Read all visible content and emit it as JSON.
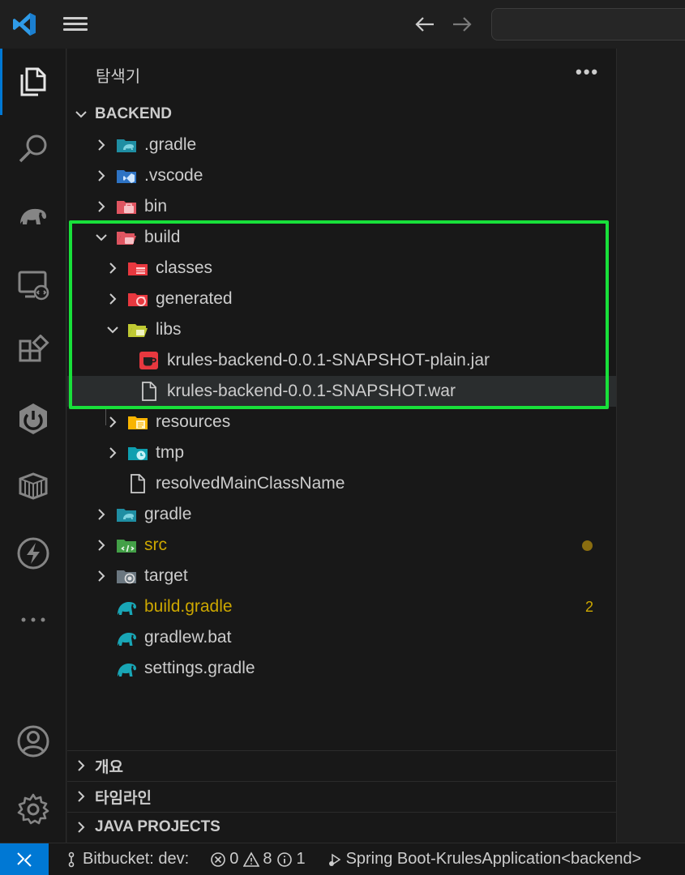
{
  "titlebar": {
    "logo": "vscode-logo",
    "menu_icon": "hamburger-icon",
    "back_icon": "arrow-left-icon",
    "forward_icon": "arrow-right-icon"
  },
  "activity_bar": {
    "items": [
      "explorer-icon",
      "search-icon",
      "gradle-elephant-icon",
      "remote-explorer-icon",
      "extensions-icon",
      "spring-boot-icon",
      "package-icon",
      "lightning-icon",
      "more-icon"
    ],
    "bottom": [
      "account-icon",
      "settings-gear-icon"
    ],
    "accent": "#0078d4"
  },
  "explorer": {
    "title": "탐색기",
    "more_label": "•••",
    "root_label": "BACKEND",
    "tree": [
      {
        "label": ".gradle",
        "icon": "folder-gradle-icon"
      },
      {
        "label": ".vscode",
        "icon": "folder-vscode-icon"
      },
      {
        "label": "bin",
        "icon": "folder-bin-icon"
      },
      {
        "label": "build",
        "icon": "folder-build-open-icon"
      },
      {
        "label": "classes",
        "icon": "folder-classes-icon"
      },
      {
        "label": "generated",
        "icon": "folder-generated-icon"
      },
      {
        "label": "libs",
        "icon": "folder-libs-open-icon"
      },
      {
        "label": "krules-backend-0.0.1-SNAPSHOT-plain.jar",
        "icon": "java-jar-icon"
      },
      {
        "label": "krules-backend-0.0.1-SNAPSHOT.war",
        "icon": "file-icon"
      },
      {
        "label": "resources",
        "icon": "folder-resources-icon"
      },
      {
        "label": "tmp",
        "icon": "folder-tmp-icon"
      },
      {
        "label": "resolvedMainClassName",
        "icon": "file-icon"
      },
      {
        "label": "gradle",
        "icon": "folder-gradle-icon"
      },
      {
        "label": "src",
        "icon": "folder-src-icon"
      },
      {
        "label": "target",
        "icon": "folder-target-icon"
      },
      {
        "label": "build.gradle",
        "icon": "gradle-file-icon",
        "badge": "2"
      },
      {
        "label": "gradlew.bat",
        "icon": "gradle-file-icon"
      },
      {
        "label": "settings.gradle",
        "icon": "gradle-file-icon"
      }
    ],
    "modified_color": "#cca700",
    "highlight_color": "#18e03a"
  },
  "panels": {
    "outline": "개요",
    "timeline": "타임라인",
    "java_projects": "JAVA PROJECTS"
  },
  "statusbar": {
    "branch": "Bitbucket: dev:",
    "errors": "0",
    "warnings": "8",
    "infos": "1",
    "spring": "Spring Boot-KrulesApplication<backend>",
    "remote_color": "#0078d4"
  }
}
